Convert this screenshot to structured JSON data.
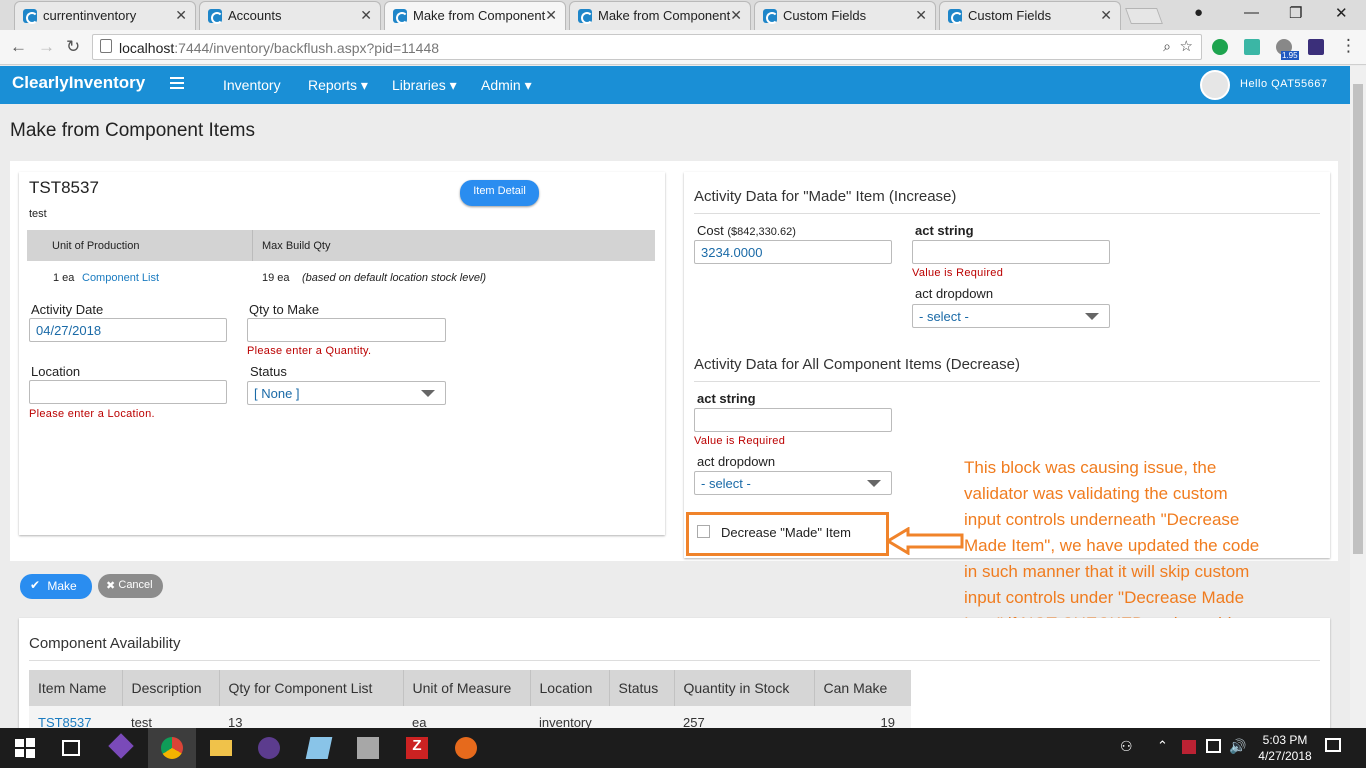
{
  "browser": {
    "tabs": [
      {
        "label": "currentinventory"
      },
      {
        "label": "Accounts"
      },
      {
        "label": "Make from Component"
      },
      {
        "label": "Make from Component"
      },
      {
        "label": "Custom Fields"
      },
      {
        "label": "Custom Fields"
      }
    ],
    "url_host": "localhost",
    "url_rest": ":7444/inventory/backflush.aspx?pid=11448",
    "ext_badge": "1.95"
  },
  "app": {
    "brand": "ClearlyInventory",
    "nav": [
      "Inventory",
      "Reports",
      "Libraries",
      "Admin"
    ],
    "greeting": "Hello QAT55667",
    "accent": "#1a8fd6"
  },
  "page_title": "Make from Component Items",
  "item": {
    "code": "TST8537",
    "description": "test",
    "detail_button": "Item Detail",
    "table_headers": [
      "Unit of Production",
      "Max Build Qty"
    ],
    "unit_of_production": "1 ea",
    "component_list_link": "Component List",
    "max_build_qty": "19 ea",
    "max_build_note": "(based on default location stock level)"
  },
  "form": {
    "activity_date_label": "Activity Date",
    "activity_date_value": "04/27/2018",
    "qty_label": "Qty to Make",
    "qty_error": "Please enter a Quantity.",
    "location_label": "Location",
    "location_error": "Please enter a Location.",
    "status_label": "Status",
    "status_value": "[ None ]"
  },
  "made_item": {
    "heading": "Activity Data for \"Made\" Item (Increase)",
    "cost_label": "Cost",
    "cost_hint": "($842,330.62)",
    "cost_value": "3234.0000",
    "act_string_label": "act string",
    "act_string_error": "Value is Required",
    "act_dropdown_label": "act dropdown",
    "act_dropdown_value": "- select -"
  },
  "components": {
    "heading": "Activity Data for All Component Items (Decrease)",
    "act_string_label": "act string",
    "act_string_error": "Value is Required",
    "act_dropdown_label": "act dropdown",
    "act_dropdown_value": "- select -",
    "decrease_checkbox_label": "Decrease \"Made\" Item",
    "decrease_checked": false
  },
  "actions": {
    "make": "Make",
    "cancel": "Cancel"
  },
  "availability": {
    "heading": "Component Availability",
    "headers": [
      "Item Name",
      "Description",
      "Qty for Component List",
      "Unit of Measure",
      "Location",
      "Status",
      "Quantity in Stock",
      "Can Make"
    ],
    "rows": [
      [
        "TST8537",
        "test",
        "13",
        "ea",
        "inventory",
        "",
        "257",
        "19"
      ]
    ]
  },
  "annotation": "This block was causing issue, the validator was validating the custom input controls underneath \"Decrease Made Item\", we have updated the code in such manner that it will skip custom input controls under \"Decrease Made Item\" if NOT CHECKED and consider when CHECKED.",
  "taskbar": {
    "time": "5:03 PM",
    "date": "4/27/2018"
  }
}
